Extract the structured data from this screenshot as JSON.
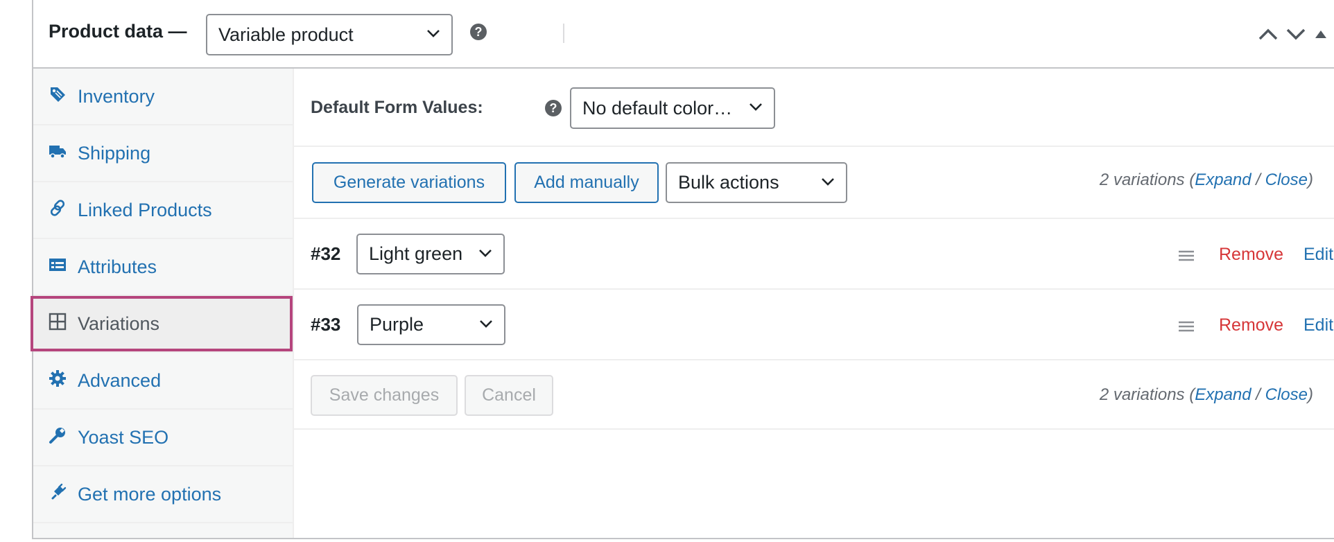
{
  "header": {
    "title": "Product data —",
    "product_type": "Variable product",
    "help_icon": "question-circle-icon",
    "controls": [
      "chevron-up-icon",
      "chevron-down-icon",
      "triangle-up-icon"
    ]
  },
  "tabs": [
    {
      "label": "Inventory",
      "icon": "tag-icon",
      "active": false
    },
    {
      "label": "Shipping",
      "icon": "truck-icon",
      "active": false
    },
    {
      "label": "Linked Products",
      "icon": "link-icon",
      "active": false
    },
    {
      "label": "Attributes",
      "icon": "list-card-icon",
      "active": false
    },
    {
      "label": "Variations",
      "icon": "grid-icon",
      "active": true
    },
    {
      "label": "Advanced",
      "icon": "gear-icon",
      "active": false
    },
    {
      "label": "Yoast SEO",
      "icon": "wrench-icon",
      "active": false
    },
    {
      "label": "Get more options",
      "icon": "plugin-icon",
      "active": false
    }
  ],
  "default_form": {
    "label": "Default Form Values:",
    "value": "No default color…"
  },
  "toolbar": {
    "generate_label": "Generate variations",
    "add_label": "Add manually",
    "bulk_label": "Bulk actions"
  },
  "summary": {
    "count_text": "2 variations",
    "open_paren": "(",
    "expand_label": "Expand",
    "slash": "/",
    "close_label": "Close",
    "close_paren": ")"
  },
  "variations": [
    {
      "id": "#32",
      "value": "Light green",
      "remove_label": "Remove",
      "edit_label": "Edit"
    },
    {
      "id": "#33",
      "value": "Purple",
      "remove_label": "Remove",
      "edit_label": "Edit"
    }
  ],
  "footer": {
    "save_label": "Save changes",
    "cancel_label": "Cancel"
  },
  "colors": {
    "link": "#2271b1",
    "remove": "#d63638",
    "active_outline": "#b5457d"
  }
}
